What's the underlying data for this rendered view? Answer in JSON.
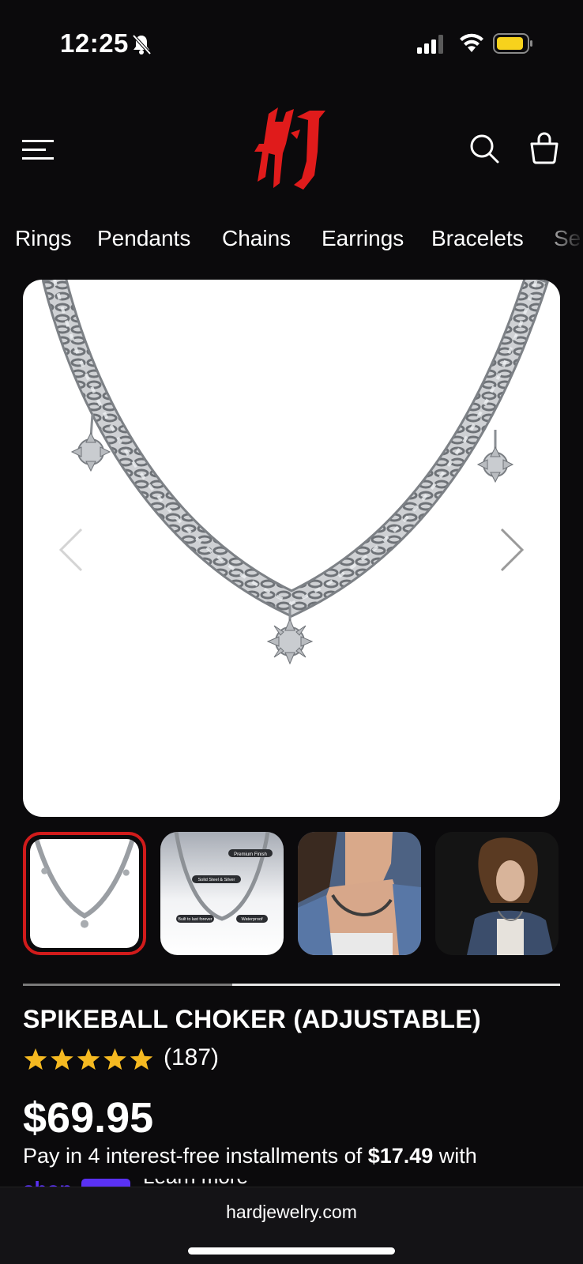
{
  "status_bar": {
    "time": "12:25",
    "icons": [
      "bell-slash-icon",
      "signal-icon",
      "wifi-icon",
      "battery-icon"
    ],
    "battery_color": "#f7d21c"
  },
  "header": {
    "logo_text": "HJ",
    "logo_color": "#e01b1b",
    "icons": [
      "menu-icon",
      "search-icon",
      "bag-icon"
    ]
  },
  "categories": [
    "Rings",
    "Pendants",
    "Chains",
    "Earrings",
    "Bracelets",
    "Se"
  ],
  "gallery": {
    "active_index": 0,
    "progress": 0.39,
    "thumb_callouts": [
      "Premium Finish",
      "Solid Steel & Silver",
      "Built to last forever",
      "Waterproof"
    ],
    "active_border_color": "#d11b1b"
  },
  "product": {
    "title": "SPIKEBALL CHOKER (ADJUSTABLE)",
    "rating": 5,
    "star_color": "#f5b921",
    "review_count": "(187)",
    "price": "$69.95",
    "installments_prefix": "Pay in 4 interest-free installments of ",
    "installment_amount": "$17.49",
    "installments_suffix": " with",
    "shop_pay_label": "shop",
    "learn_more": "Learn more"
  },
  "browser": {
    "url": "hardjewelry.com"
  }
}
